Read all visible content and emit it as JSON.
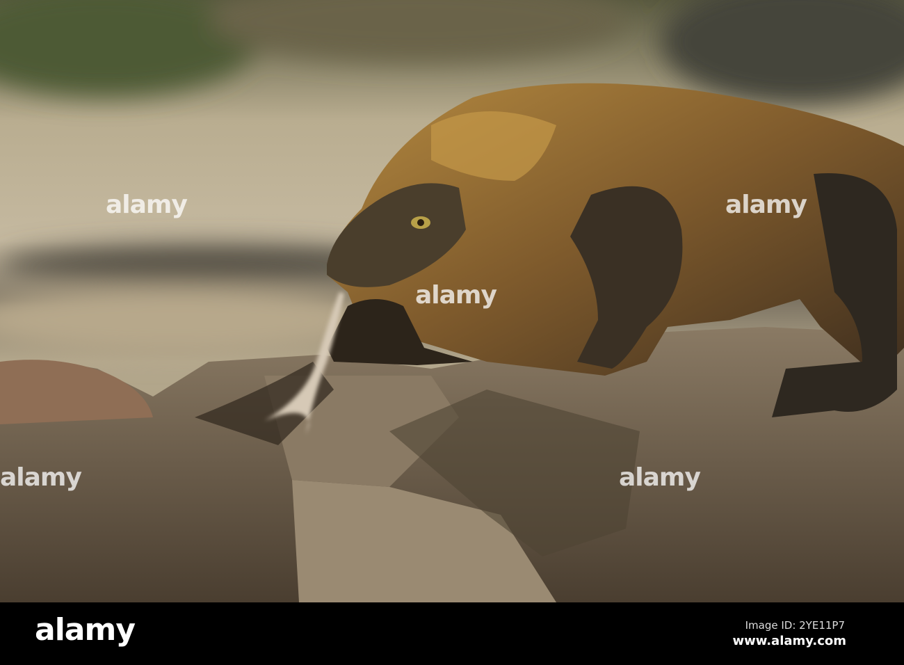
{
  "photo": {
    "subject": "komodo-dragon-on-rock"
  },
  "watermark": {
    "text": "alamy"
  },
  "footer": {
    "logo": "alamy",
    "image_id": "Image ID: 2YE11P7",
    "url": "www.alamy.com"
  },
  "colors": {
    "bar": "#000000",
    "background_rock": "#b9ab8e",
    "dragon": "#7a5a30",
    "rock": "#6e5e4c"
  }
}
